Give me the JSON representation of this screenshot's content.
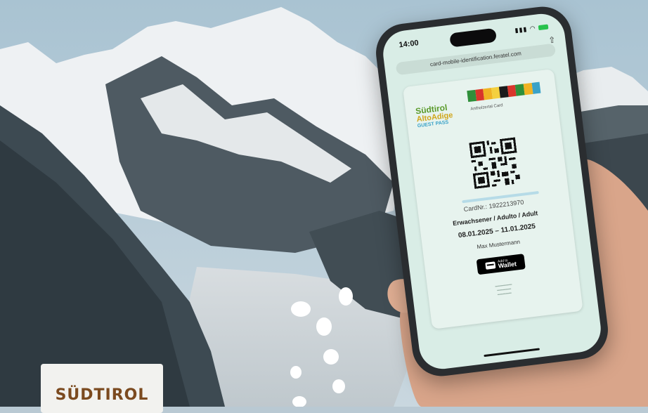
{
  "phone": {
    "status_time": "14:00",
    "url": "card-mobile-identification.feratel.com",
    "card": {
      "logo_line1": "Südtirol",
      "logo_line2": "AltoAdige",
      "logo_line3": "GUEST PASS",
      "card_name": "Antholzertal Card",
      "stripe_colors": [
        "#2f8f3a",
        "#d9352b",
        "#f0b323",
        "#f4d03f",
        "#1b1b1b",
        "#d9352b",
        "#2f8f3a",
        "#f0b323",
        "#3aa2c8"
      ],
      "card_nr": "CardNr.: 1922213970",
      "type": "Erwachsener / Adulto / Adult",
      "dates": "08.01.2025 – 11.01.2025",
      "holder": "Max Mustermann",
      "wallet_line1": "Add to",
      "wallet_line2": "Wallet"
    }
  },
  "logo": {
    "text": "SÜDTIROL"
  }
}
